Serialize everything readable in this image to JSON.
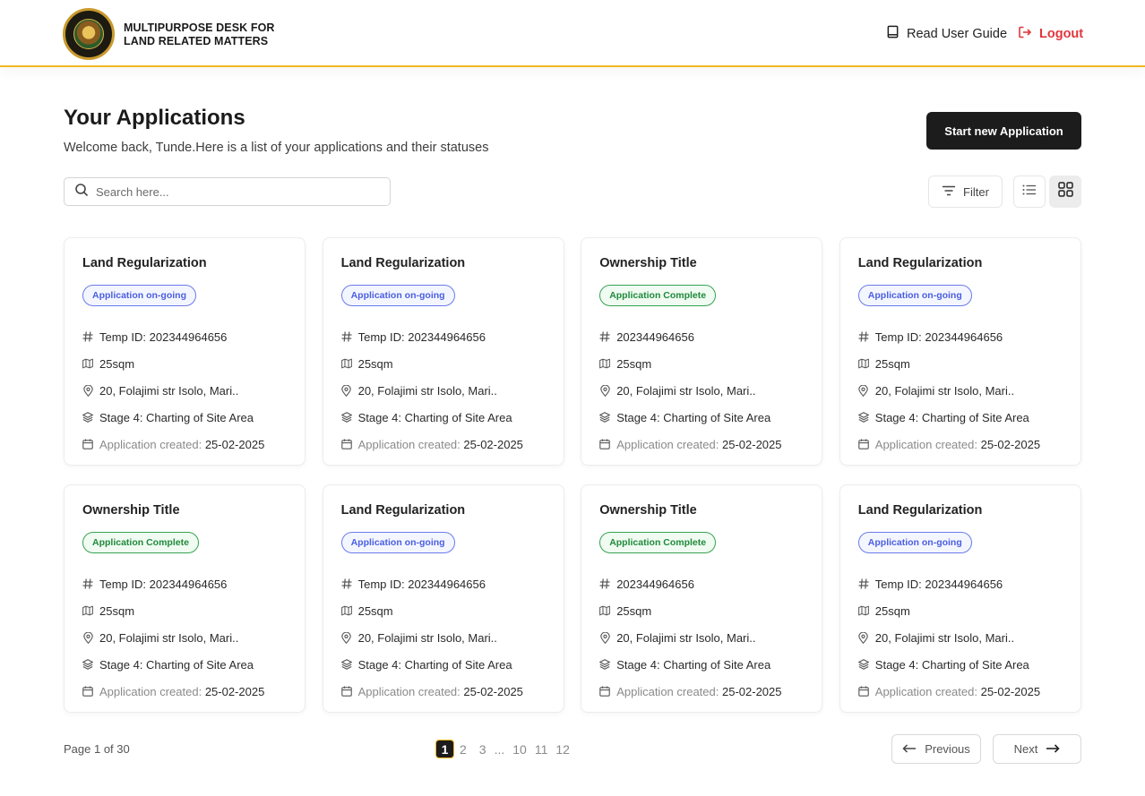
{
  "header": {
    "brand_line1": "MULTIPURPOSE DESK FOR",
    "brand_line2": "LAND RELATED MATTERS",
    "guide_label": "Read User Guide",
    "logout_label": "Logout",
    "accent_color": "#f2b81d",
    "logout_color": "#e0363c"
  },
  "main": {
    "title": "Your Applications",
    "subtitle": "Welcome back, Tunde.Here is a list of your applications and their statuses",
    "start_button": "Start new Application",
    "search_placeholder": "Search here...",
    "filter_label": "Filter"
  },
  "cards": [
    {
      "title": "Land Regularization",
      "status": "Application on-going",
      "status_type": "ongoing",
      "id": "Temp ID: 202344964656",
      "size": "25sqm",
      "address": "20, Folajimi str Isolo, Mari..",
      "stage": "Stage 4: Charting of Site Area",
      "created_label": "Application created:",
      "created_date": "25-02-2025"
    },
    {
      "title": "Land Regularization",
      "status": "Application on-going",
      "status_type": "ongoing",
      "id": "Temp ID: 202344964656",
      "size": "25sqm",
      "address": "20, Folajimi str Isolo, Mari..",
      "stage": "Stage 4: Charting of Site Area",
      "created_label": "Application created:",
      "created_date": "25-02-2025"
    },
    {
      "title": "Ownership Title",
      "status": "Application Complete",
      "status_type": "complete",
      "id": "202344964656",
      "size": "25sqm",
      "address": "20, Folajimi str Isolo, Mari..",
      "stage": "Stage 4: Charting of Site Area",
      "created_label": "Application created:",
      "created_date": "25-02-2025"
    },
    {
      "title": "Land Regularization",
      "status": "Application on-going",
      "status_type": "ongoing",
      "id": "Temp ID: 202344964656",
      "size": "25sqm",
      "address": "20, Folajimi str Isolo, Mari..",
      "stage": "Stage 4: Charting of Site Area",
      "created_label": "Application created:",
      "created_date": "25-02-2025"
    },
    {
      "title": "Ownership Title",
      "status": "Application Complete",
      "status_type": "complete",
      "id": "Temp ID: 202344964656",
      "size": "25sqm",
      "address": "20, Folajimi str Isolo, Mari..",
      "stage": "Stage 4: Charting of Site Area",
      "created_label": "Application created:",
      "created_date": "25-02-2025"
    },
    {
      "title": "Land Regularization",
      "status": "Application on-going",
      "status_type": "ongoing",
      "id": "Temp ID: 202344964656",
      "size": "25sqm",
      "address": "20, Folajimi str Isolo, Mari..",
      "stage": "Stage 4: Charting of Site Area",
      "created_label": "Application created:",
      "created_date": "25-02-2025"
    },
    {
      "title": "Ownership Title",
      "status": "Application Complete",
      "status_type": "complete",
      "id": "202344964656",
      "size": "25sqm",
      "address": "20, Folajimi str Isolo, Mari..",
      "stage": "Stage 4: Charting of Site Area",
      "created_label": "Application created:",
      "created_date": "25-02-2025"
    },
    {
      "title": "Land Regularization",
      "status": "Application on-going",
      "status_type": "ongoing",
      "id": "Temp ID: 202344964656",
      "size": "25sqm",
      "address": "20, Folajimi str Isolo, Mari..",
      "stage": "Stage 4: Charting of Site Area",
      "created_label": "Application created:",
      "created_date": "25-02-2025"
    }
  ],
  "pagination": {
    "page_info": "Page 1 of 30",
    "pages": [
      "1",
      "2",
      "3",
      "...",
      "10",
      "11",
      "12"
    ],
    "current": "1",
    "previous_label": "Previous",
    "next_label": "Next"
  }
}
